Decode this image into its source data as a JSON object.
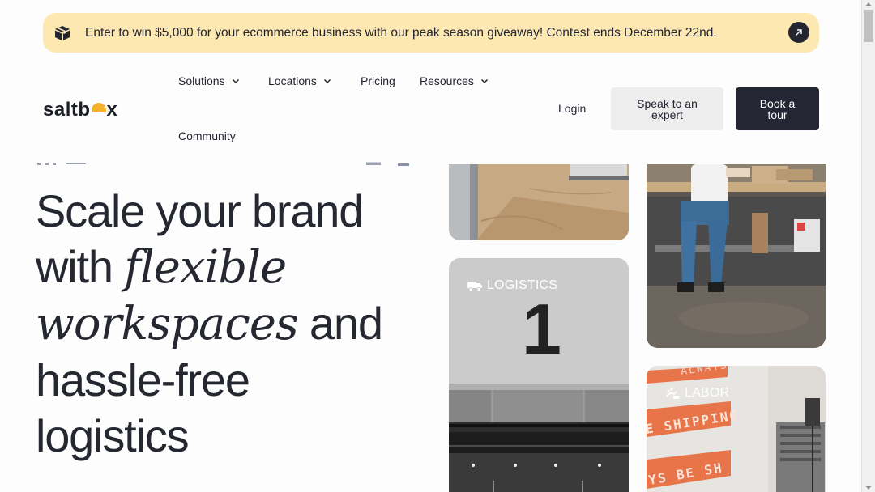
{
  "banner": {
    "text": "Enter to win $5,000 for your ecommerce business with our peak season giveaway! Contest ends December 22nd.",
    "icon": "package-box-icon",
    "action_icon": "arrow-up-right-icon",
    "bg_color": "#fde8b2"
  },
  "header": {
    "logo_text_before": "saltb",
    "logo_text_after": "x",
    "nav": {
      "solutions": "Solutions",
      "locations": "Locations",
      "pricing": "Pricing",
      "resources": "Resources",
      "community": "Community"
    },
    "login": "Login",
    "speak_button": "Speak to an expert",
    "book_button": "Book a tour"
  },
  "hero": {
    "line1": "Scale your brand",
    "line2_plain": "with ",
    "line2_italic": "flexible",
    "line3_italic": "workspaces",
    "line3_plain": " and",
    "line4": "hassle-free",
    "line5": "logistics"
  },
  "cards": {
    "logistics_label": "LOGISTICS",
    "logistics_number": "1",
    "labor_label": "LABOR",
    "banner_text_top": "ALWAYS",
    "banner_text_mid": "E SHIPPING",
    "banner_text_low": "YS BE SH"
  },
  "colors": {
    "dark": "#242633",
    "accent_yellow": "#f6b12b",
    "labor_orange": "#e8744a"
  }
}
